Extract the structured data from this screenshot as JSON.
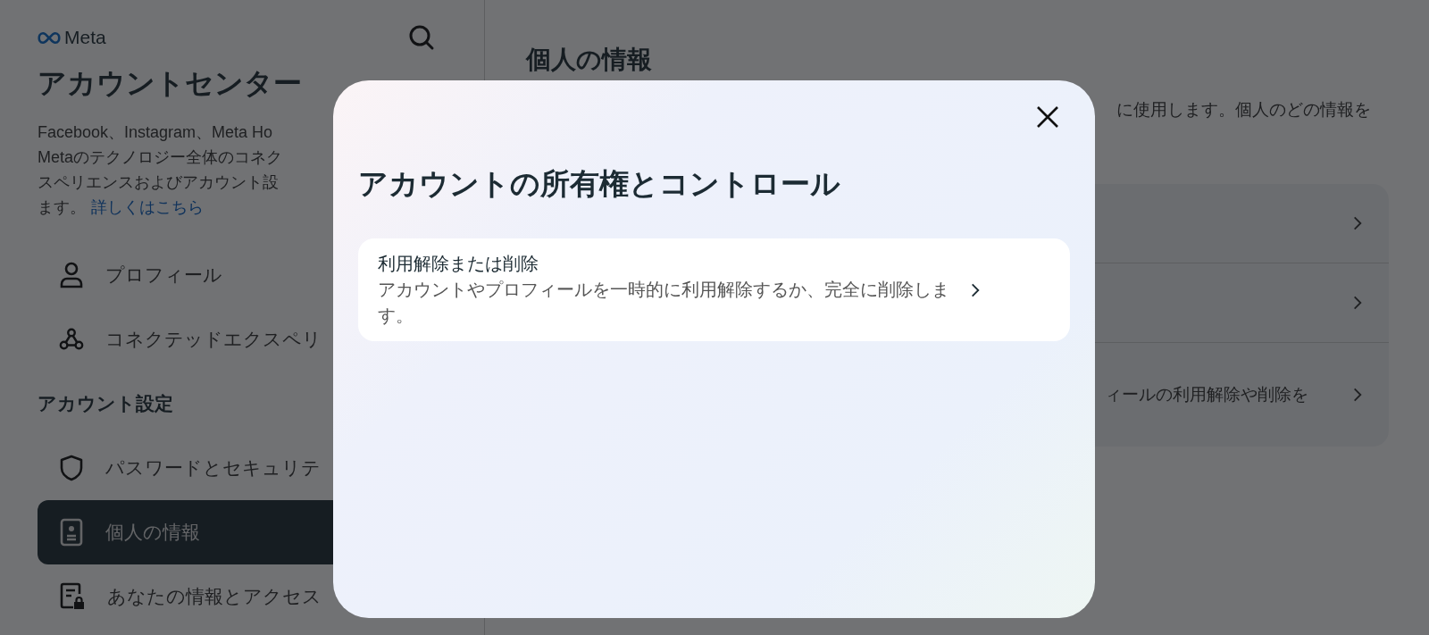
{
  "sidebar": {
    "logo": "Meta",
    "title": "アカウントセンター",
    "description_lines": [
      "Facebook、Instagram、Meta Ho",
      "Metaのテクノロジー全体のコネク",
      "スペリエンスおよびアカウント設"
    ],
    "description_end": "ます。",
    "learn_more_link": "詳しくはこちら",
    "items": [
      {
        "kind": "profile",
        "label": "プロフィール",
        "selected": false
      },
      {
        "kind": "connected",
        "label": "コネクテッドエクスペリ",
        "selected": false
      },
      {
        "kind": "heading",
        "label": "アカウント設定"
      },
      {
        "kind": "password",
        "label": "パスワードとセキュリテ",
        "selected": false
      },
      {
        "kind": "personal-info",
        "label": "個人の情報",
        "selected": true
      },
      {
        "kind": "your-info",
        "label": "あなたの情報とアクセス",
        "selected": false
      }
    ]
  },
  "main": {
    "title": "個人の情報",
    "description": "に使用します。個人のどの情報を",
    "rows": [
      {
        "kind": "link"
      },
      {
        "kind": "link"
      },
      {
        "kind": "link",
        "label": "ィールの利用解除や削除を"
      }
    ]
  },
  "dialog": {
    "title": "アカウントの所有権とコントロール",
    "options": [
      {
        "title": "利用解除または削除",
        "description": "アカウントやプロフィールを一時的に利用解除するか、完全に削除します。"
      }
    ]
  }
}
